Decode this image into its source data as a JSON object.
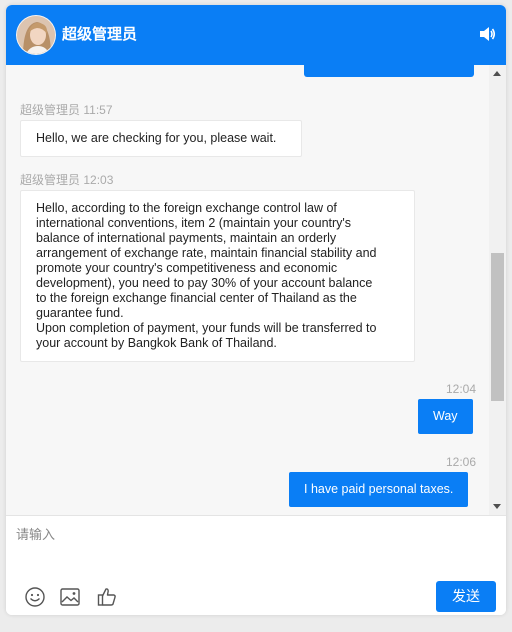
{
  "header": {
    "title": "超级管理员",
    "avatar_icon": "avatar-woman",
    "sound_icon": "speaker-icon"
  },
  "messages": [
    {
      "direction": "in",
      "sender": "超级管理员",
      "time": "11:57",
      "text": "Hello, we are checking for you, please wait."
    },
    {
      "direction": "in",
      "sender": "超级管理员",
      "time": "12:03",
      "lines": [
        "Hello, according to the foreign exchange control law of",
        "international conventions, item 2 (maintain your country's",
        "balance of international payments, maintain an orderly",
        "arrangement of exchange rate, maintain financial stability and",
        "promote your country's competitiveness and economic",
        "development), you need to pay 30% of your account balance",
        "to the foreign exchange financial center of Thailand as the",
        "guarantee fund.",
        "Upon completion of payment, your funds will be transferred to",
        "your account by Bangkok Bank of Thailand."
      ]
    },
    {
      "direction": "out",
      "time": "12:04",
      "text": "Way"
    },
    {
      "direction": "out",
      "time": "12:06",
      "text": "I have paid personal taxes."
    }
  ],
  "input": {
    "placeholder": "请输入",
    "value": ""
  },
  "toolbar": {
    "emoji_icon": "smiley-icon",
    "image_icon": "image-icon",
    "like_icon": "thumbs-up-icon",
    "send_label": "发送"
  },
  "colors": {
    "accent": "#0a7ef5",
    "chat_background": "#f7f7f7",
    "meta_text": "#aaaaaa"
  }
}
